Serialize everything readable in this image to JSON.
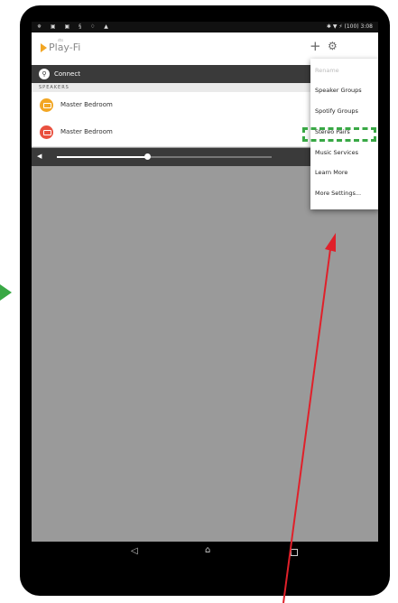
{
  "status_bar": {
    "left_icons": "✵ ▣ ▣ § ♢ ▲",
    "right_text": "✱ ▼ ⚡ (100) 3:08"
  },
  "app_bar": {
    "logo_small": "dts",
    "logo_text": "Play-Fi",
    "add_icon": "plus-icon",
    "settings_icon": "gear-icon"
  },
  "connect": {
    "label": "Connect"
  },
  "speakers": {
    "header": "SPEAKERS",
    "items": [
      {
        "name": "Master Bedroom",
        "color": "#f2a623"
      },
      {
        "name": "Master Bedroom",
        "color": "#e9503f"
      }
    ]
  },
  "volume": {
    "level": 0.42
  },
  "menu": {
    "items": [
      {
        "label": "Rename",
        "enabled": false
      },
      {
        "label": "Speaker Groups",
        "enabled": true
      },
      {
        "label": "Spotify Groups",
        "enabled": true
      },
      {
        "label": "Stereo Pairs",
        "enabled": true
      },
      {
        "label": "Music Services",
        "enabled": true
      },
      {
        "label": "Learn More",
        "enabled": true
      },
      {
        "label": "More Settings...",
        "enabled": true
      }
    ]
  },
  "nav": {
    "back": "◁",
    "home": "⌂"
  },
  "colors": {
    "highlight": "#39a845",
    "annotation_arrow": "#e0202a",
    "accent": "#f2a623"
  }
}
